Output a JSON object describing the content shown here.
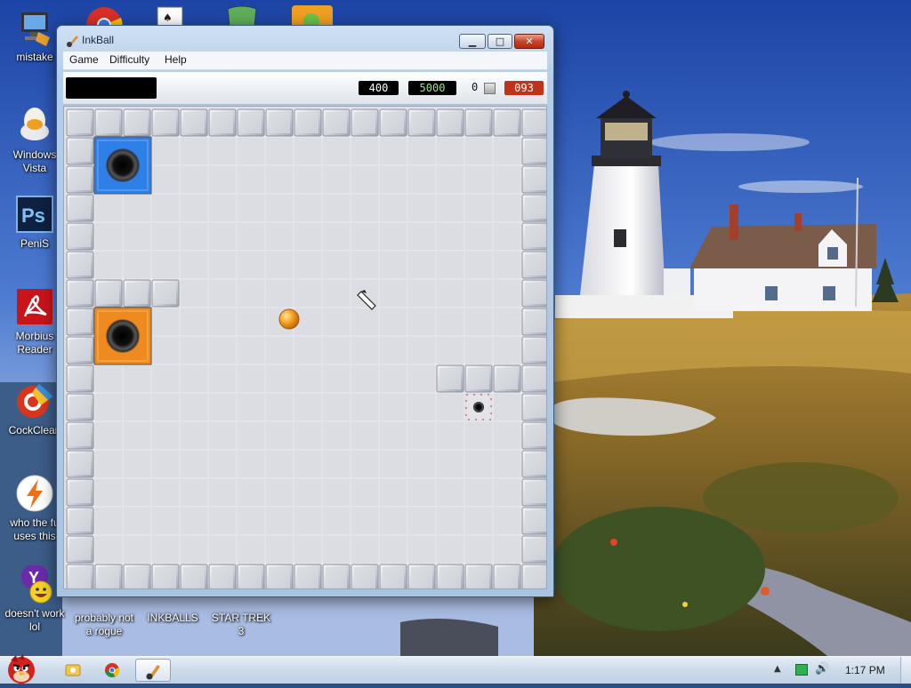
{
  "desktop": {
    "icons": [
      {
        "label": "mistake",
        "icon": "computer-icon"
      },
      {
        "label": "Windows Vista",
        "icon": "windows-vista-icon"
      },
      {
        "label": "PeniS",
        "icon": "photoshop-icon"
      },
      {
        "label": "Morbius Reader",
        "icon": "pdf-reader-icon"
      },
      {
        "label": "CockClean",
        "icon": "ccleaner-icon"
      },
      {
        "label": "who the fu uses this",
        "icon": "lightning-icon"
      },
      {
        "label": "doesn't work lol",
        "icon": "yahoo-messenger-icon"
      },
      {
        "label": "probably not a rogue",
        "icon": "rogue-icon"
      },
      {
        "label": "INKBALLS",
        "icon": "inkball-icon"
      },
      {
        "label": "STAR TREK 3",
        "icon": "star-trek-icon"
      }
    ],
    "top_icons": [
      "chrome-icon",
      "solitaire-icon",
      "security-shield-icon",
      "angry-birds-icon"
    ]
  },
  "window": {
    "title": "InkBall",
    "controls": {
      "minimize": "minimize",
      "maximize": "maximize",
      "close": "close"
    },
    "menu": [
      "Game",
      "Difficulty",
      "Help"
    ],
    "status": {
      "score": "400",
      "target": "5000",
      "balls": "0",
      "timer": "093"
    }
  },
  "game": {
    "ball_color": "orange",
    "holes": [
      {
        "color": "blue",
        "hex": "#2f7fe8"
      },
      {
        "color": "orange",
        "hex": "#ef8a1e"
      },
      {
        "color": "gray",
        "hex": "#9a9a9a"
      }
    ]
  },
  "taskbar": {
    "clock": "1:17 PM",
    "apps": [
      "windows-explorer-icon",
      "chrome-icon",
      "inkball-icon"
    ],
    "tray": [
      "show-hidden-icons-icon",
      "network-icon",
      "volume-icon"
    ]
  },
  "colors": {
    "score_bg": "#000000",
    "target_text": "#9fe08e",
    "timer_bg": "#c0331b",
    "tile": "#c9cdd5",
    "floor": "#dcdde3"
  }
}
